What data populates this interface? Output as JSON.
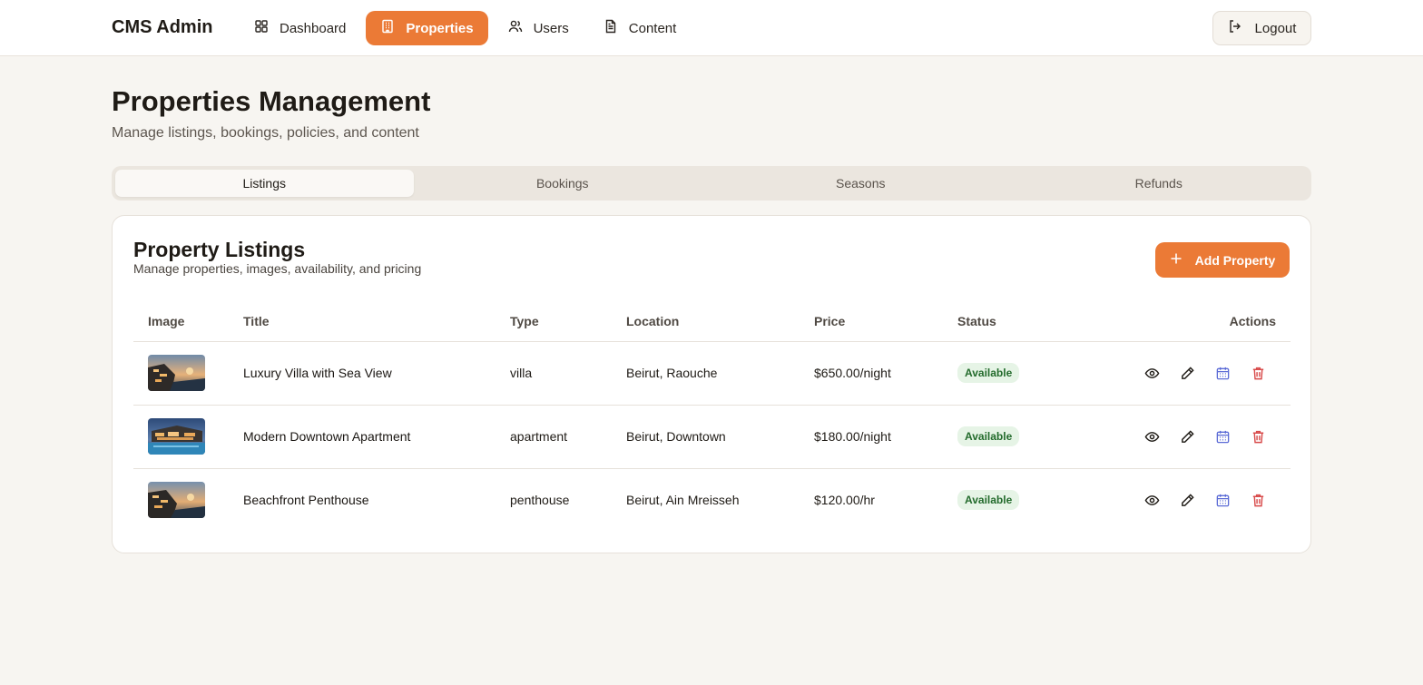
{
  "app": {
    "brand": "CMS Admin"
  },
  "nav": {
    "items": [
      {
        "label": "Dashboard",
        "icon": "dashboard-icon",
        "active": false
      },
      {
        "label": "Properties",
        "icon": "building-icon",
        "active": true
      },
      {
        "label": "Users",
        "icon": "users-icon",
        "active": false
      },
      {
        "label": "Content",
        "icon": "document-icon",
        "active": false
      }
    ],
    "logout_label": "Logout"
  },
  "page": {
    "title": "Properties Management",
    "subtitle": "Manage listings, bookings, policies, and content"
  },
  "tabs": [
    {
      "label": "Listings",
      "active": true
    },
    {
      "label": "Bookings",
      "active": false
    },
    {
      "label": "Seasons",
      "active": false
    },
    {
      "label": "Refunds",
      "active": false
    }
  ],
  "listings": {
    "title": "Property Listings",
    "subtitle": "Manage properties, images, availability, and pricing",
    "add_label": "Add Property",
    "columns": [
      "Image",
      "Title",
      "Type",
      "Location",
      "Price",
      "Status",
      "Actions"
    ],
    "rows": [
      {
        "title": "Luxury Villa with Sea View",
        "type": "villa",
        "location": "Beirut, Raouche",
        "price": "$650.00/night",
        "status": "Available"
      },
      {
        "title": "Modern Downtown Apartment",
        "type": "apartment",
        "location": "Beirut, Downtown",
        "price": "$180.00/night",
        "status": "Available"
      },
      {
        "title": "Beachfront Penthouse",
        "type": "penthouse",
        "location": "Beirut, Ain Mreisseh",
        "price": "$120.00/hr",
        "status": "Available"
      }
    ]
  },
  "colors": {
    "accent": "#eb7a36",
    "background": "#f7f5f1",
    "status_bg": "#e6f4e6",
    "status_text": "#236b2c",
    "calendar_icon": "#5b6bd6",
    "delete_icon": "#d84a4a"
  }
}
